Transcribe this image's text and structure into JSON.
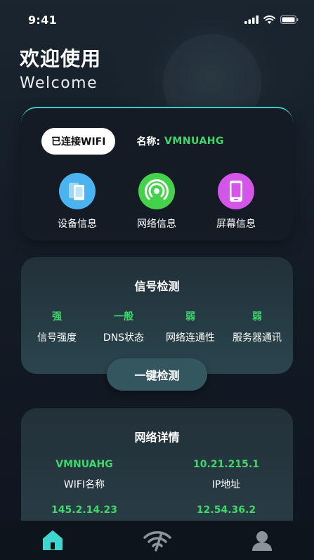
{
  "status_bar": {
    "time": "9:41"
  },
  "greeting": {
    "title": "欢迎使用",
    "subtitle": "Welcome"
  },
  "wifi": {
    "status_label": "已连接WIFI",
    "name_label": "名称:",
    "name_value": "VMNUAHG",
    "features": [
      {
        "label": "设备信息",
        "icon": "device-icon",
        "color": "#4ab3f0"
      },
      {
        "label": "网络信息",
        "icon": "signal-icon",
        "color": "#45d14c"
      },
      {
        "label": "屏幕信息",
        "icon": "phone-icon",
        "color": "#d456e8"
      }
    ]
  },
  "signal": {
    "title": "信号检测",
    "metrics": [
      {
        "value": "强",
        "label": "信号强度"
      },
      {
        "value": "一般",
        "label": "DNS状态"
      },
      {
        "value": "弱",
        "label": "网络连通性"
      },
      {
        "value": "弱",
        "label": "服务器通讯"
      }
    ],
    "button_label": "一键检测"
  },
  "details": {
    "title": "网络详情",
    "items": [
      {
        "value": "VMNUAHG",
        "label": "WIFI名称"
      },
      {
        "value": "10.21.215.1",
        "label": "IP地址"
      },
      {
        "value": "145.2.14.23",
        "label": ""
      },
      {
        "value": "12.54.36.2",
        "label": ""
      }
    ]
  },
  "tabs": [
    {
      "icon": "home-icon",
      "active": true
    },
    {
      "icon": "wifi-slash-icon",
      "active": false
    },
    {
      "icon": "user-icon",
      "active": false
    }
  ],
  "colors": {
    "accent_green": "#3fd86a",
    "accent_teal": "#3fc9c5"
  }
}
